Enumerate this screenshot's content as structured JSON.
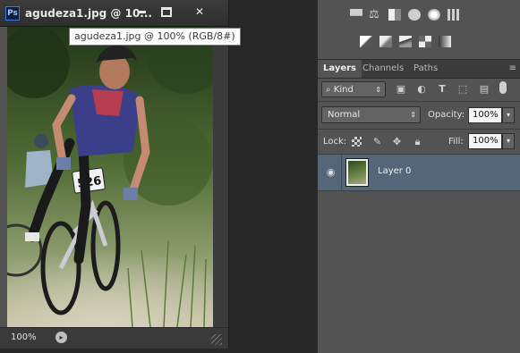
{
  "document": {
    "app_icon": "Ps",
    "title": "agudeza1.jpg @ 10...",
    "tooltip": "agudeza1.jpg @ 100% (RGB/8#)",
    "window_buttons": {
      "minimize_icon": "minimize-icon",
      "maximize_icon": "maximize-icon",
      "close_glyph": "✕"
    },
    "status": {
      "zoom": "100%",
      "menu_glyph": "▸"
    },
    "photo": {
      "bib_number": "526"
    }
  },
  "adjustments": {
    "row1_icons": [
      "brightness-contrast-icon",
      "levels-icon",
      "curves-icon",
      "exposure-icon",
      "vibrance-icon",
      "hue-saturation-icon"
    ],
    "row2_icons": [
      "invert-icon",
      "posterize-icon",
      "threshold-icon",
      "selective-color-icon",
      "gradient-map-icon"
    ]
  },
  "layers_panel": {
    "tabs": [
      {
        "label": "Layers",
        "active": true
      },
      {
        "label": "Channels",
        "active": false
      },
      {
        "label": "Paths",
        "active": false
      }
    ],
    "menu_glyph": "≡",
    "filter": {
      "kind_label": "Kind",
      "search_glyph": "⌕",
      "arrows": "⇕",
      "filter_icons": [
        "image-filter-icon",
        "adjustment-filter-icon",
        "type-filter-icon",
        "shape-filter-icon",
        "smart-object-filter-icon"
      ]
    },
    "blend_mode": "Normal",
    "opacity_label": "Opacity:",
    "opacity_value": "100%",
    "lock_label": "Lock:",
    "fill_label": "Fill:",
    "fill_value": "100%",
    "dropdown_arrow": "▾",
    "layers": [
      {
        "name": "Layer 0",
        "visible": true,
        "selected": true
      }
    ]
  },
  "colors": {
    "panel_bg": "#535353",
    "selected_layer_bg": "#556679",
    "workspace_bg": "#282828"
  }
}
